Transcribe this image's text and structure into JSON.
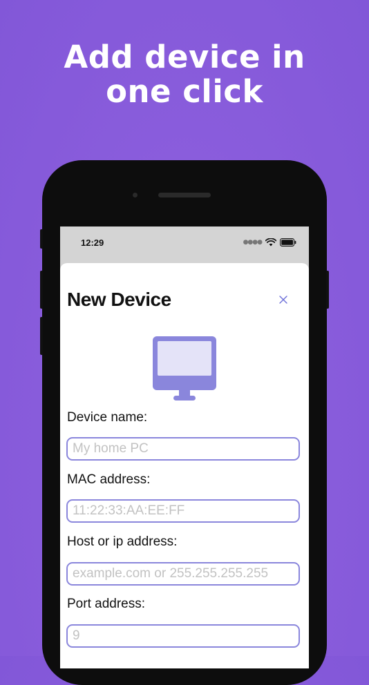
{
  "promo": {
    "headline_line1": "Add device in",
    "headline_line2": "one click"
  },
  "status_bar": {
    "time": "12:29",
    "icons": [
      "signal-dots-icon",
      "wifi-icon",
      "battery-icon"
    ]
  },
  "sheet": {
    "title": "New Device",
    "close_icon": "close-icon",
    "device_icon": "monitor-icon"
  },
  "form": {
    "device_name": {
      "label": "Device name:",
      "placeholder": "My home PC",
      "value": ""
    },
    "mac_address": {
      "label": "MAC address:",
      "placeholder": "11:22:33:AA:EE:FF",
      "value": ""
    },
    "host": {
      "label": "Host or ip address:",
      "placeholder": "example.com or 255.255.255.255",
      "value": ""
    },
    "port": {
      "label": "Port address:",
      "placeholder": "9",
      "value": ""
    }
  },
  "colors": {
    "background": "#8a5ddc",
    "accent": "#8a86dc",
    "monitor": "#8a86dc",
    "monitor_screen": "#e4e3f8"
  }
}
